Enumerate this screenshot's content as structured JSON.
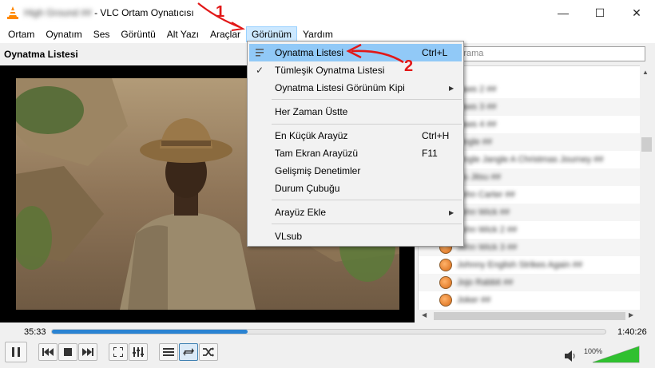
{
  "window": {
    "title_blurred": "High Ground ##",
    "title_suffix": " - VLC Ortam Oynatıcısı",
    "minimize": "—",
    "maximize": "☐",
    "close": "✕"
  },
  "menubar": {
    "items": [
      "Ortam",
      "Oynatım",
      "Ses",
      "Görüntü",
      "Alt Yazı",
      "Araçlar",
      "Görünüm",
      "Yardım"
    ],
    "active_index": 6
  },
  "playlist": {
    "header": "Oynatma Listesi",
    "search_placeholder": "Arama",
    "rows": [
      "Jaws 2 ##",
      "Jaws 3 ##",
      "Jaws 4 ##",
      "Jingle ##",
      "Jingle Jangle A Christmas Journey ##",
      "Jiu Jitsu ##",
      "John Carter ##",
      "John Wick ##",
      "John Wick 2 ##",
      "John Wick 3 ##",
      "Johnny English Strikes Again ##",
      "Jojo Rabbit ##",
      "Joker ##"
    ],
    "row_visible_prefixes": [
      "",
      "",
      "",
      "",
      "",
      "",
      "",
      "",
      "",
      "",
      "",
      "Jojo",
      "Jok"
    ]
  },
  "dropdown": {
    "items": [
      {
        "label": "Oynatma Listesi",
        "shortcut": "Ctrl+L",
        "icon": "playlist-icon",
        "highlighted": true
      },
      {
        "label": "Tümleşik Oynatma Listesi",
        "check": "✓"
      },
      {
        "label": "Oynatma Listesi Görünüm Kipi",
        "submenu": "▶"
      },
      {
        "label": "Her Zaman Üstte"
      },
      {
        "label": "En Küçük Arayüz",
        "shortcut": "Ctrl+H"
      },
      {
        "label": "Tam Ekran Arayüzü",
        "shortcut": "F11"
      },
      {
        "label": "Gelişmiş Denetimler"
      },
      {
        "label": "Durum Çubuğu"
      },
      {
        "label": "Arayüz Ekle",
        "submenu": "▶"
      },
      {
        "label": "VLsub"
      }
    ]
  },
  "player": {
    "elapsed": "35:33",
    "total": "1:40:26",
    "progress": 0.354,
    "volume_label": "100%",
    "volume_level": 1.0
  },
  "annotations": {
    "step1": "1",
    "step2": "2",
    "color": "#e21818"
  }
}
